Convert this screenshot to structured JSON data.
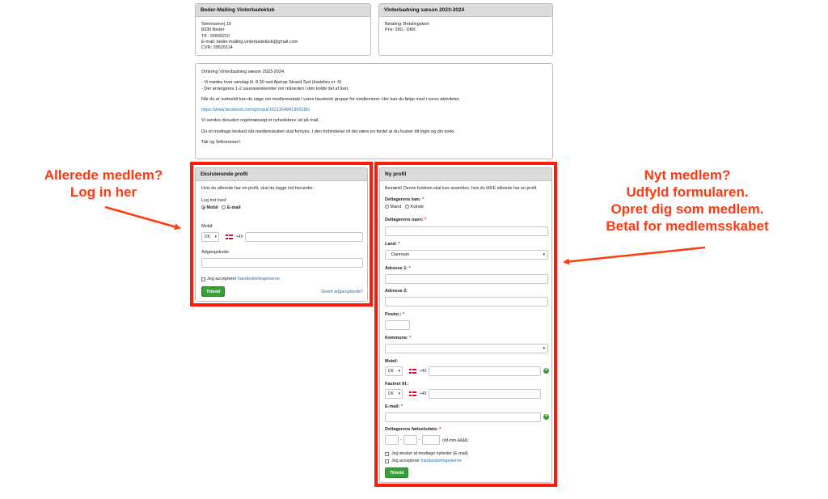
{
  "club_panel": {
    "title": "Beder-Malling Vinterbadeklub",
    "lines": [
      "Stenrosevej 19",
      "8330 Beder",
      "Tlf.: 29900210",
      "E-mail: beder.malling.vinterbadeklub@gmail.com",
      "CVR: 39529114"
    ]
  },
  "season_panel": {
    "title": "Vinterbadning sæson 2023-2024",
    "lines": [
      "Betaling: Betalingskort",
      "Pris: 350,- DKK"
    ]
  },
  "info_panel": {
    "p1": "Omkring Vinterbadning sæson 2023-2024.",
    "p2a": "- Vi mødes hver søndag kl. 8.30 ved Ajstrup Strand Syd (badebro nr. 4)",
    "p2b": "- Der arrangeres 1-2 saunaweekender om måneden i den kolde del af året.",
    "p3": "Når du er indmeldt kan du søge om medlemsskab i vores facebook gruppe for medlemmer. Her kan du følge med i vores aktiviteter.",
    "link": "https://www.facebook.com/groups/1621264841365286/",
    "p4": "Vi sendes desuden regelmæssigt et nyhedsbrev ud på mail.",
    "p5": "Du vil modtage besked når medlemskabet skal fornyes. I den forbindelse vil det være en fordel at du husker dit login og din kode.",
    "p6": "Tak og Velkommen!"
  },
  "existing": {
    "title": "Eksisterende profil",
    "intro": "Hvis du allerede har en profil, skal du logge ind herunder.",
    "login_with": "Log ind med:",
    "opt_mobile": "Mobil",
    "opt_email": "E-mail",
    "mobile_label": "Mobil:",
    "country_code": "DK",
    "dial": "+45",
    "password_label": "Adgangskode:",
    "accept_text": "Jeg accepterer ",
    "accept_link": "handelsbetingelserne",
    "submit": "Tilmeld",
    "forgot": "Glemt adgangskode?"
  },
  "newprofile": {
    "title": "Ny profil",
    "note": "Bemærk! Denne funktion skal kun anvendes, hvis du IKKE allerede har en profil.",
    "gender_label": "Deltagerens køn:",
    "opt_male": "Mand",
    "opt_female": "Kvinde",
    "name_label": "Deltagerens navn:",
    "country_label": "Land:",
    "country_value": "Danmark",
    "addr1_label": "Adresse 1:",
    "addr2_label": "Adresse 2:",
    "zip_label": "Postnr.:",
    "municipality_label": "Kommune:",
    "mobile_label": "Mobil:",
    "landline_label": "Fastnet tlf.:",
    "country_code": "DK",
    "dial": "+45",
    "email_label": "E-mail:",
    "dob_label": "Deltagerens fødselsdato:",
    "dob_sep": "-",
    "dob_format": "(dd-mm-åååå)",
    "newsletter": "Jeg ønsker at modtage nyheder (E-mail)",
    "accept_text": "Jeg accepterer ",
    "accept_link": "handelsbetingelserne",
    "submit": "Tilmeld",
    "req": "*"
  },
  "annotations": {
    "left_line1": "Allerede medlem?",
    "left_line2": "Log in her",
    "right_line1": "Nyt medlem?",
    "right_line2": "Udfyld formularen.",
    "right_line3": "Opret dig som medlem.",
    "right_line4": "Betal for medlemsskabet"
  },
  "colors": {
    "highlight_red": "#ff1a0a",
    "annotation_orange_red": "#ff3a10",
    "button_green": "#3c9c3c",
    "link_blue": "#2a6fb0"
  }
}
